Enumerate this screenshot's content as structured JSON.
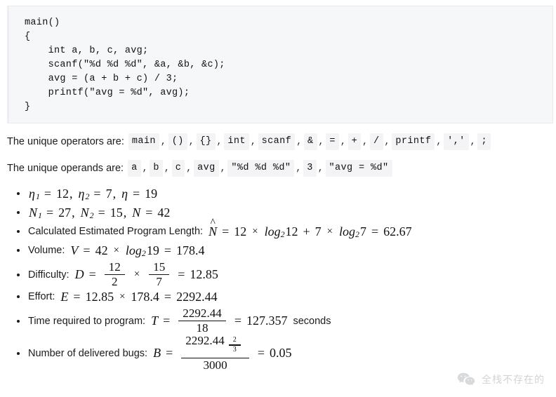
{
  "code_block": {
    "language": "c",
    "lines": [
      "main()",
      "{",
      "    int a, b, c, avg;",
      "    scanf(\"%d %d %d\", &a, &b, &c);",
      "    avg = (a + b + c) / 3;",
      "    printf(\"avg = %d\", avg);",
      "}"
    ],
    "text": "main()\n{\n    int a, b, c, avg;\n    scanf(\"%d %d %d\", &a, &b, &c);\n    avg = (a + b + c) / 3;\n    printf(\"avg = %d\", avg);\n}"
  },
  "operators": {
    "lead": "The unique operators are:",
    "items": [
      "main",
      "()",
      "{}",
      "int",
      "scanf",
      "&",
      "=",
      "+",
      "/",
      "printf",
      "'",
      "'",
      ";"
    ],
    "rendered": [
      "main",
      "()",
      "{}",
      "int",
      "scanf",
      "&",
      "=",
      "+",
      "/",
      "printf",
      "','",
      ";"
    ],
    "separator": ","
  },
  "operands": {
    "lead": "The unique operands are:",
    "items": [
      "a",
      "b",
      "c",
      "avg",
      "\"%d %d %d\"",
      "3",
      "\"avg = %d\""
    ],
    "separator": ","
  },
  "metrics": {
    "counts": {
      "eta1_label": "η",
      "eta1_sub": "1",
      "eta1_value": "12",
      "eta2_label": "η",
      "eta2_sub": "2",
      "eta2_value": "7",
      "eta_label": "η",
      "eta_value": "19"
    },
    "totals": {
      "n1_label": "N",
      "n1_sub": "1",
      "n1_value": "27",
      "n2_label": "N",
      "n2_sub": "2",
      "n2_value": "15",
      "n_label": "N",
      "n_value": "42"
    },
    "length": {
      "label": "Calculated Estimated Program Length:",
      "symbol": "N",
      "accent": "^",
      "term1_coeff": "12",
      "log_name": "log",
      "log_base": "2",
      "term1_arg": "12",
      "plus": "+",
      "term2_coeff": "7",
      "term2_arg": "7",
      "result": "62.67"
    },
    "volume": {
      "label": "Volume:",
      "symbol": "V",
      "factor": "42",
      "log_name": "log",
      "log_base": "2",
      "log_arg": "19",
      "result": "178.4"
    },
    "difficulty": {
      "label": "Difficulty:",
      "symbol": "D",
      "frac1_num": "12",
      "frac1_den": "2",
      "frac2_num": "15",
      "frac2_den": "7",
      "result": "12.85"
    },
    "effort": {
      "label": "Effort:",
      "symbol": "E",
      "factor1": "12.85",
      "factor2": "178.4",
      "result": "2292.44"
    },
    "time": {
      "label": "Time required to program:",
      "symbol": "T",
      "numerator": "2292.44",
      "denominator": "18",
      "result": "127.357",
      "unit": "seconds"
    },
    "bugs": {
      "label": "Number of delivered bugs:",
      "symbol": "B",
      "numerator_base": "2292.44",
      "exp_num": "2",
      "exp_den": "3",
      "denominator": "3000",
      "result": "0.05"
    },
    "symbols": {
      "equals": "=",
      "times": "×",
      "comma": ","
    }
  },
  "watermark": {
    "icon": "wechat-icon",
    "text": "全栈不存在的"
  }
}
